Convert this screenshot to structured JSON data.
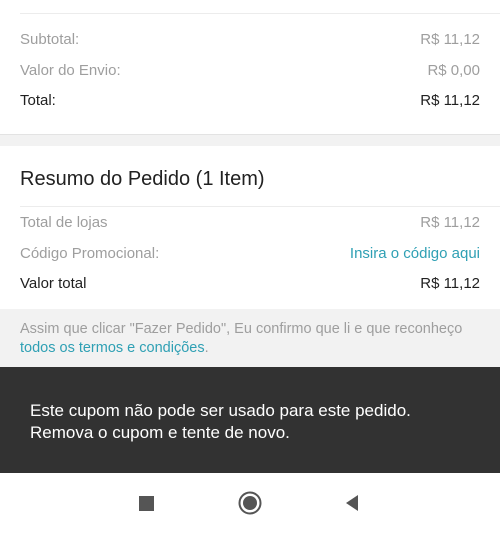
{
  "summary_top": {
    "subtotal_label": "Subtotal:",
    "subtotal_value": "R$ 11,12",
    "shipping_label": "Valor do Envio:",
    "shipping_value": "R$ 0,00",
    "total_label": "Total:",
    "total_value": "R$ 11,12"
  },
  "order_summary": {
    "title": "Resumo do Pedido (1 Item)",
    "stores_total_label": "Total de lojas",
    "stores_total_value": "R$ 11,12",
    "promo_label": "Código Promocional:",
    "promo_link": "Insira o código aqui",
    "grand_total_label": "Valor total",
    "grand_total_value": "R$ 11,12"
  },
  "terms": {
    "text_before": "Assim que clicar \"Fazer Pedido\", Eu confirmo que li e que reconheço ",
    "link": "todos os termos e condições",
    "text_after": "."
  },
  "toast": {
    "line1": "Este cupom não pode ser usado para este pedido.",
    "line2": "Remova o cupom e tente de novo."
  },
  "navbar": {
    "icons": [
      "recents-icon",
      "home-icon",
      "back-icon"
    ]
  },
  "colors": {
    "accent_link": "#2fa0b4",
    "toast_bg": "#323232",
    "muted_text": "#9e9e9e",
    "strong_text": "#212121"
  }
}
